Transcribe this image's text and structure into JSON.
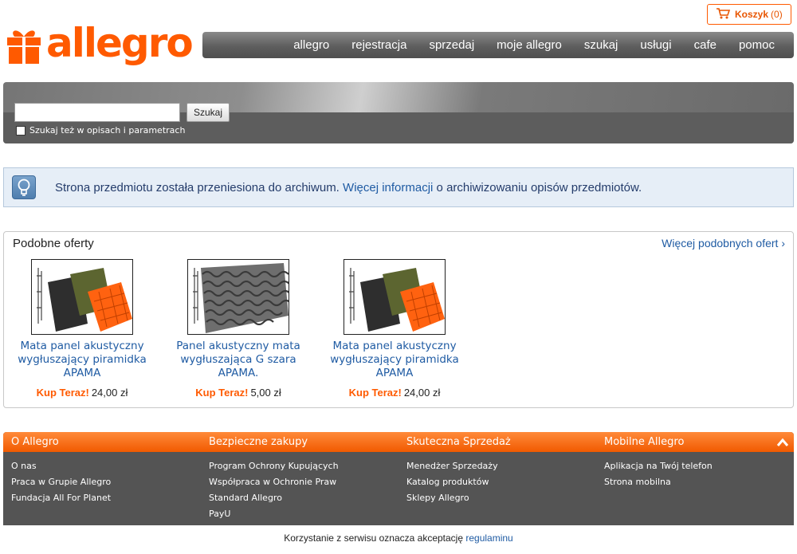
{
  "header": {
    "logo_text": "allegro",
    "cart": {
      "label": "Koszyk",
      "count": "(0)"
    },
    "nav": [
      "allegro",
      "rejestracja",
      "sprzedaj",
      "moje allegro",
      "szukaj",
      "usługi",
      "cafe",
      "pomoc"
    ]
  },
  "search": {
    "value": "",
    "button": "Szukaj",
    "checkbox_label": "Szukaj też w opisach i parametrach"
  },
  "info": {
    "text_before": "Strona przedmiotu została przeniesiona do archiwum. ",
    "link": "Więcej informacji",
    "text_after": " o archiwizowaniu opisów przedmiotów."
  },
  "offers": {
    "title": "Podobne oferty",
    "more": "Więcej podobnych ofert ›",
    "items": [
      {
        "title": "Mata panel akustyczny wygłuszający piramidka APAMA",
        "buy": "Kup Teraz!",
        "price": "24,00 zł"
      },
      {
        "title": "Panel akustyczny mata wygłuszająca G szara APAMA.",
        "buy": "Kup Teraz!",
        "price": "5,00 zł"
      },
      {
        "title": "Mata panel akustyczny wygłuszający piramidka APAMA",
        "buy": "Kup Teraz!",
        "price": "24,00 zł"
      }
    ]
  },
  "footer": {
    "columns": [
      {
        "title": "O Allegro",
        "links": [
          "O nas",
          "Praca w Grupie Allegro",
          "Fundacja All For Planet"
        ]
      },
      {
        "title": "Bezpieczne zakupy",
        "links": [
          "Program Ochrony Kupujących",
          "Współpraca w Ochronie Praw",
          "Standard Allegro",
          "PayU"
        ]
      },
      {
        "title": "Skuteczna Sprzedaż",
        "links": [
          "Menedżer Sprzedaży",
          "Katalog produktów",
          "Sklepy Allegro"
        ]
      },
      {
        "title": "Mobilne Allegro",
        "links": [
          "Aplikacja na Twój telefon",
          "Strona mobilna"
        ]
      }
    ],
    "terms_text": "Korzystanie z serwisu oznacza akceptację ",
    "terms_link": "regulaminu"
  },
  "colors": {
    "brand_orange": "#ff5a00",
    "link_blue": "#1f5ba3",
    "footer_bg": "#545454"
  }
}
